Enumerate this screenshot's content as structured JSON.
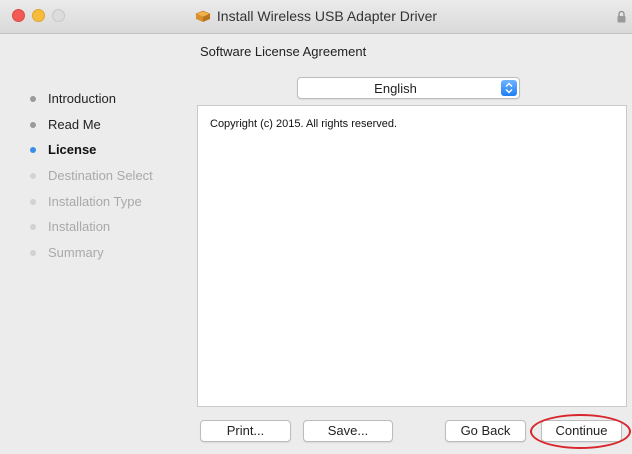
{
  "window": {
    "title": "Install Wireless USB Adapter Driver",
    "title_icon": "package-icon",
    "lock_icon": "lock-icon"
  },
  "header": {
    "title": "Software License Agreement"
  },
  "language_select": {
    "value": "English",
    "icon": "stepper-icon",
    "accent_color": "#1f7ef3"
  },
  "license": {
    "text": "Copyright (c) 2015.  All rights reserved."
  },
  "sidebar": {
    "items": [
      {
        "label": "Introduction",
        "state": "done"
      },
      {
        "label": "Read Me",
        "state": "done"
      },
      {
        "label": "License",
        "state": "current"
      },
      {
        "label": "Destination Select",
        "state": "todo"
      },
      {
        "label": "Installation Type",
        "state": "todo"
      },
      {
        "label": "Installation",
        "state": "todo"
      },
      {
        "label": "Summary",
        "state": "todo"
      }
    ],
    "current_color": "#3a8ee6"
  },
  "buttons": {
    "print": "Print...",
    "save": "Save...",
    "go_back": "Go Back",
    "continue": "Continue"
  },
  "annotation": {
    "color": "#d8262c"
  }
}
